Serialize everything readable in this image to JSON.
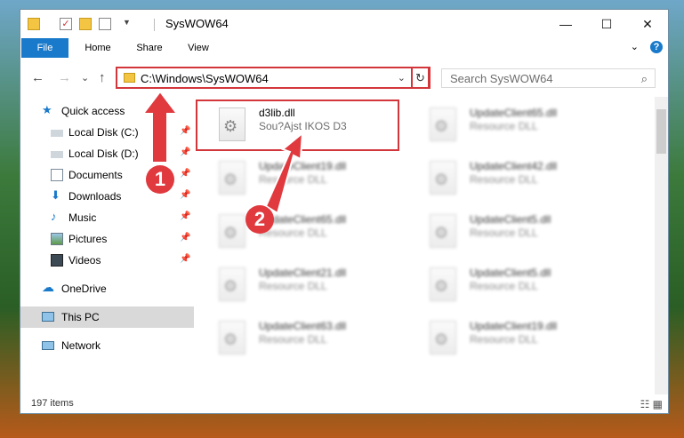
{
  "window": {
    "title": "SysWOW64",
    "controls": {
      "minimize": "—",
      "maximize": "☐",
      "close": "✕"
    }
  },
  "ribbon": {
    "tabs": [
      "File",
      "Home",
      "Share",
      "View"
    ],
    "expand": "⌄",
    "help": "?"
  },
  "addressbar": {
    "path": "C:\\Windows\\SysWOW64",
    "refresh": "↻",
    "search_placeholder": "Search SysWOW64",
    "chevron": "⌄"
  },
  "nav": {
    "back": "←",
    "forward": "→",
    "recent": "⌄",
    "up": "↑"
  },
  "sidebar": {
    "items": [
      {
        "label": "Quick access",
        "icon": "star-icon"
      },
      {
        "label": "Local Disk (C:)",
        "icon": "drive-icon",
        "pinned": true
      },
      {
        "label": "Local Disk (D:)",
        "icon": "drive-icon",
        "pinned": true
      },
      {
        "label": "Documents",
        "icon": "documents-icon",
        "pinned": true
      },
      {
        "label": "Downloads",
        "icon": "download-icon",
        "pinned": true
      },
      {
        "label": "Music",
        "icon": "music-icon",
        "pinned": true
      },
      {
        "label": "Pictures",
        "icon": "pictures-icon",
        "pinned": true
      },
      {
        "label": "Videos",
        "icon": "videos-icon",
        "pinned": true
      },
      {
        "label": "OneDrive",
        "icon": "cloud-icon"
      },
      {
        "label": "This PC",
        "icon": "computer-icon",
        "selected": true
      },
      {
        "label": "Network",
        "icon": "network-icon"
      }
    ],
    "pin_glyph": "📌"
  },
  "files": [
    {
      "name": "d3lib.dll",
      "type": "Sou?Ajst IKOS D3",
      "highlighted": true
    },
    {
      "name": "UpdateClient65.dll",
      "type": "Resource DLL"
    },
    {
      "name": "UpdateClient19.dll",
      "type": "Resource DLL"
    },
    {
      "name": "UpdateClient42.dll",
      "type": "Resource DLL"
    },
    {
      "name": "UpdateClient65.dll",
      "type": "Resource DLL"
    },
    {
      "name": "UpdateClient5.dll",
      "type": "Resource DLL"
    },
    {
      "name": "UpdateClient21.dll",
      "type": "Resource DLL"
    },
    {
      "name": "UpdateClient5.dll",
      "type": "Resource DLL"
    },
    {
      "name": "UpdateClient63.dll",
      "type": "Resource DLL"
    },
    {
      "name": "UpdateClient19.dll",
      "type": "Resource DLL"
    }
  ],
  "status": {
    "count": "197 items",
    "views": "☷ ▦"
  },
  "callouts": [
    "1",
    "2"
  ],
  "colors": {
    "accent": "#1979ca",
    "highlight": "#d2363b"
  }
}
